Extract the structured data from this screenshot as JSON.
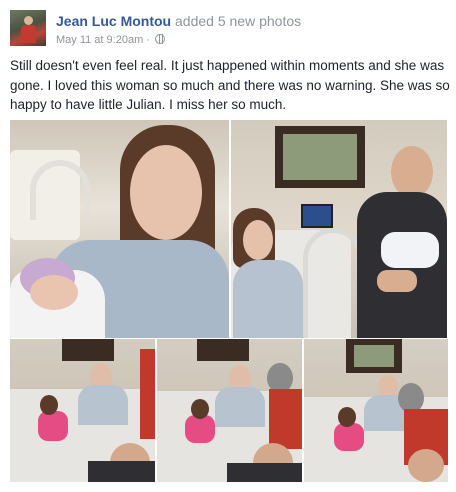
{
  "post": {
    "author": "Jean Luc Montou",
    "action": "added 5 new photos",
    "timestamp": "May 11 at 9:20am",
    "separator": "·",
    "privacy_icon": "globe-icon",
    "status_text": "Still doesn't even feel real. It just happened within moments and she was gone. I loved this woman so much and there was no warning. She was so happy to have little Julian. I miss her so much."
  },
  "colors": {
    "author_link": "#365899",
    "secondary_text": "#90949c",
    "body_text": "#1d2129"
  },
  "photos": {
    "count": 5
  }
}
